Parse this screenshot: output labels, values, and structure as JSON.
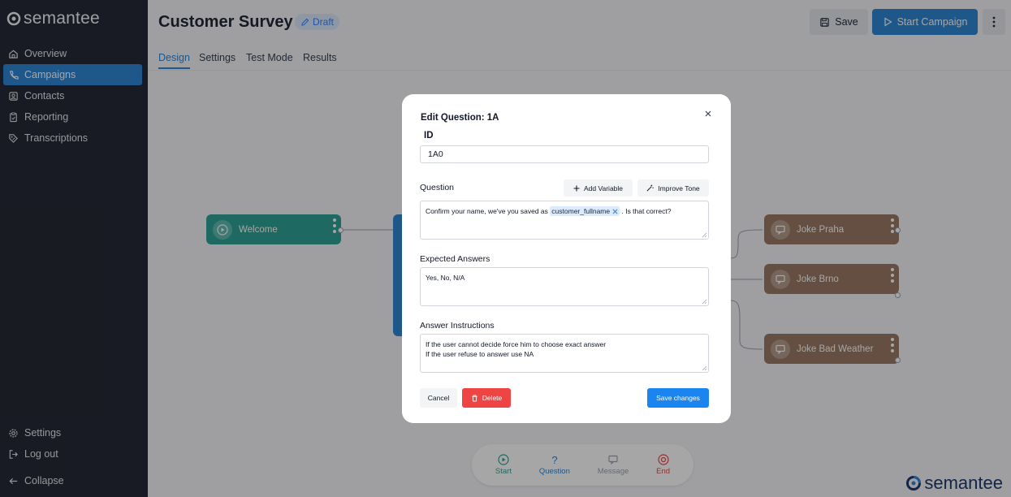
{
  "sidebar": {
    "brand": "semantee",
    "items": [
      {
        "label": "Overview",
        "icon": "home-icon"
      },
      {
        "label": "Campaigns",
        "icon": "phone-icon",
        "active": true
      },
      {
        "label": "Contacts",
        "icon": "contacts-icon"
      },
      {
        "label": "Reporting",
        "icon": "reporting-icon"
      },
      {
        "label": "Transcriptions",
        "icon": "transcriptions-icon"
      }
    ],
    "bottom": [
      {
        "label": "Settings",
        "icon": "gear-icon"
      },
      {
        "label": "Log out",
        "icon": "logout-icon"
      },
      {
        "label": "Collapse",
        "icon": "arrow-left-icon"
      }
    ]
  },
  "header": {
    "title": "Customer Survey",
    "badge": "Draft",
    "save_label": "Save",
    "start_label": "Start Campaign",
    "tabs": [
      "Design",
      "Settings",
      "Test Mode",
      "Results"
    ],
    "active_tab": "Design"
  },
  "flow": {
    "nodes": [
      {
        "label": "Welcome",
        "color": "#2ea398"
      },
      {
        "label": "Joke Praha",
        "color": "#9b7a66"
      },
      {
        "label": "Joke Brno",
        "color": "#9b7a66"
      },
      {
        "label": "Joke Bad Weather",
        "color": "#9b7a66"
      }
    ]
  },
  "palette": {
    "items": [
      {
        "label": "Start",
        "color": "#2ea398"
      },
      {
        "label": "Question",
        "color": "#2f86d4"
      },
      {
        "label": "Message",
        "color": "#9ca3af"
      },
      {
        "label": "End",
        "color": "#ef4444"
      }
    ]
  },
  "modal": {
    "title": "Edit Question: 1A",
    "id_label": "ID",
    "id_value": "1A0",
    "question_label": "Question",
    "add_variable": "Add Variable",
    "improve_tone": "Improve Tone",
    "question_text_before": "Confirm your name, we've you saved as",
    "question_variable": "customer_fullname",
    "question_text_after": ". Is that correct?",
    "expected_label": "Expected Answers",
    "expected_value": "Yes, No, N/A",
    "instructions_label": "Answer Instructions",
    "instructions_line1": "If the user cannot decide force him to choose exact answer",
    "instructions_line2": "If the user refuse to answer use NA",
    "cancel": "Cancel",
    "delete": "Delete",
    "save_changes": "Save changes"
  },
  "brand_footer": "semantee"
}
